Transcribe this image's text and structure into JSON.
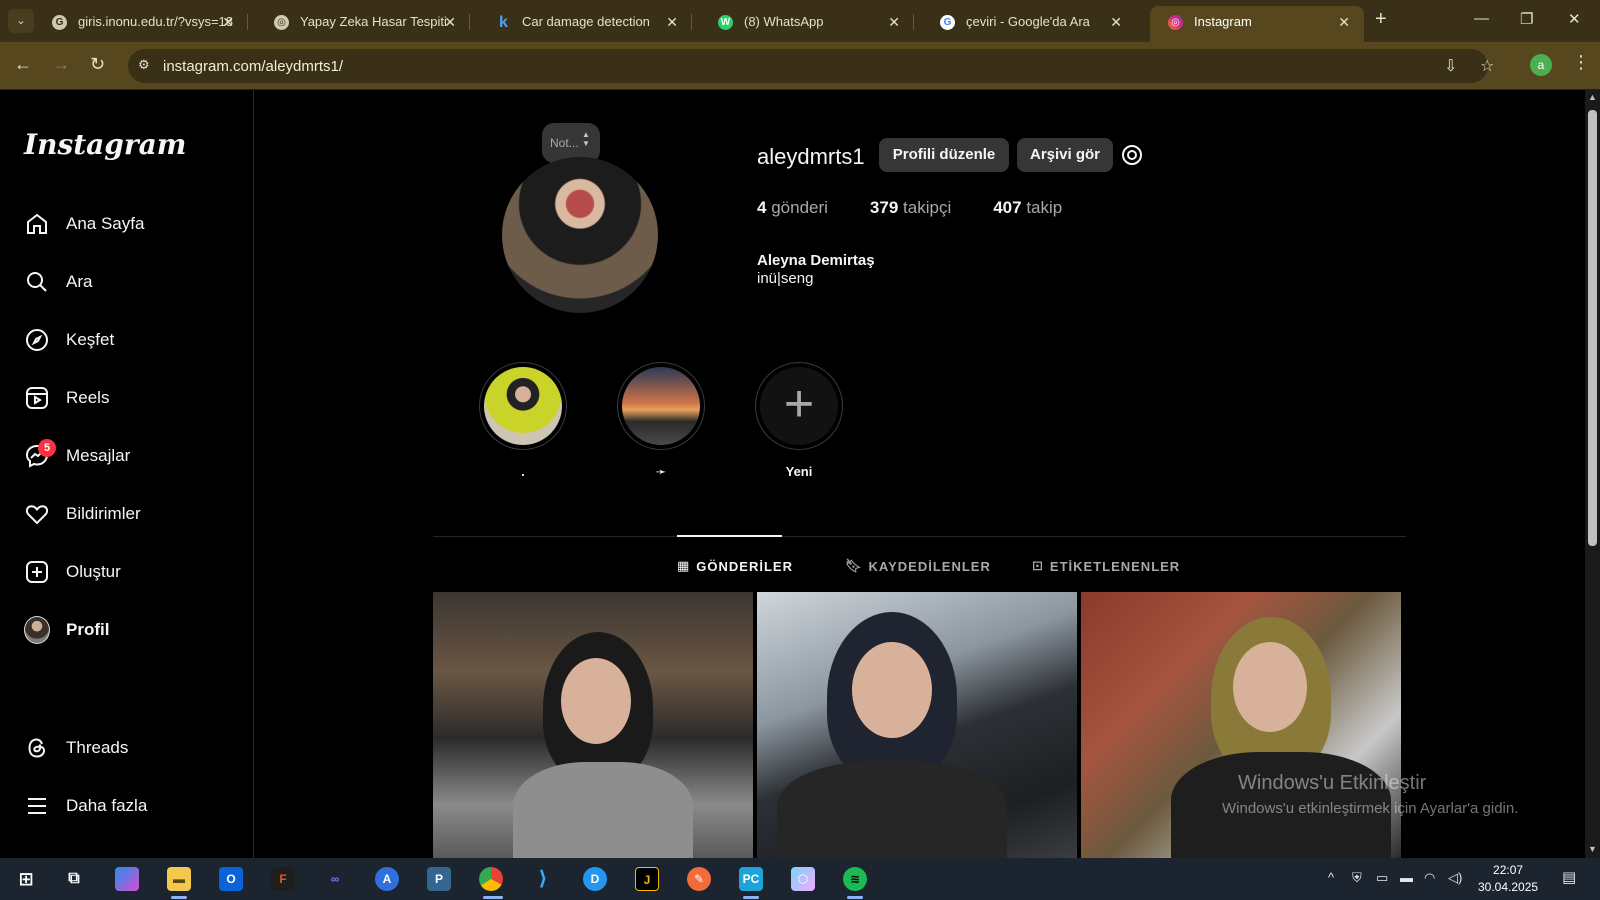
{
  "browser": {
    "tabs": [
      {
        "title": "giris.inonu.edu.tr/?vsys=18",
        "fav": "G"
      },
      {
        "title": "Yapay Zeka Hasar Tespiti",
        "fav": "◎"
      },
      {
        "title": "Car damage detection",
        "fav": "k"
      },
      {
        "title": "(8) WhatsApp",
        "fav": "W"
      },
      {
        "title": "çeviri - Google'da Ara",
        "fav": "G"
      },
      {
        "title": "Instagram",
        "fav": "◎"
      }
    ],
    "url": "instagram.com/aleydmrts1/",
    "profile_initial": "a"
  },
  "sidebar": {
    "logo": "Instagram",
    "items": [
      {
        "label": "Ana Sayfa",
        "icon": "home-icon"
      },
      {
        "label": "Ara",
        "icon": "search-icon"
      },
      {
        "label": "Keşfet",
        "icon": "compass-icon"
      },
      {
        "label": "Reels",
        "icon": "reels-icon"
      },
      {
        "label": "Mesajlar",
        "icon": "messenger-icon",
        "badge": "5"
      },
      {
        "label": "Bildirimler",
        "icon": "heart-icon"
      },
      {
        "label": "Oluştur",
        "icon": "plus-square-icon"
      },
      {
        "label": "Profil",
        "icon": "avatar"
      },
      {
        "label": "Threads",
        "icon": "threads-icon"
      },
      {
        "label": "Daha fazla",
        "icon": "menu-icon"
      }
    ]
  },
  "profile": {
    "note": "Not...",
    "username": "aleydmrts1",
    "edit_button": "Profili düzenle",
    "archive_button": "Arşivi gör",
    "posts_count": "4",
    "posts_label": "gönderi",
    "followers_count": "379",
    "followers_label": "takipçi",
    "following_count": "407",
    "following_label": "takip",
    "full_name": "Aleyna Demirtaş",
    "bio": "inü|seng"
  },
  "highlights": [
    {
      "label": "."
    },
    {
      "label": "➛"
    },
    {
      "label": "Yeni"
    }
  ],
  "tabs": [
    {
      "label": "GÖNDERİLER",
      "icon": "grid-icon"
    },
    {
      "label": "KAYDEDİLENLER",
      "icon": "bookmark-icon"
    },
    {
      "label": "ETİKETLENENLER",
      "icon": "tag-icon"
    }
  ],
  "watermark": {
    "line1": "Windows'u Etkinleştir",
    "line2": "Windows'u etkinleştirmek için Ayarlar'a gidin."
  },
  "taskbar": {
    "time": "22:07",
    "date": "30.04.2025"
  }
}
